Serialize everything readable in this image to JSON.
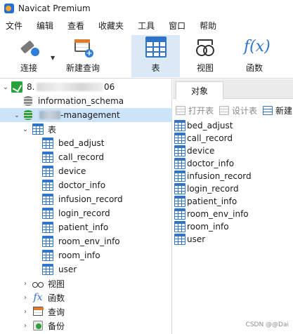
{
  "window": {
    "title": "Navicat Premium"
  },
  "menu": [
    "文件",
    "编辑",
    "查看",
    "收藏夹",
    "工具",
    "窗口",
    "帮助"
  ],
  "toolbar": {
    "connect": "连接",
    "new_query": "新建查询",
    "table": "表",
    "view": "视图",
    "function": "函数",
    "active": "表"
  },
  "sidebar": {
    "connection_prefix": "8.",
    "connection_suffix": "06",
    "db_info_schema": "information_schema",
    "db_selected_suffix": "-management",
    "tables_group": "表",
    "tables": [
      "bed_adjust",
      "call_record",
      "device",
      "doctor_info",
      "infusion_record",
      "login_record",
      "patient_info",
      "room_env_info",
      "room_info",
      "user"
    ],
    "view_group": "视图",
    "function_group": "函数",
    "query_group": "查询",
    "backup_group": "备份"
  },
  "objects_panel": {
    "tab": "对象",
    "open_table": "打开表",
    "design_table": "设计表",
    "new_table_partial": "新建",
    "tables": [
      "bed_adjust",
      "call_record",
      "device",
      "doctor_info",
      "infusion_record",
      "login_record",
      "patient_info",
      "room_env_info",
      "room_info",
      "user"
    ]
  },
  "watermark": "CSDN @@Dai"
}
